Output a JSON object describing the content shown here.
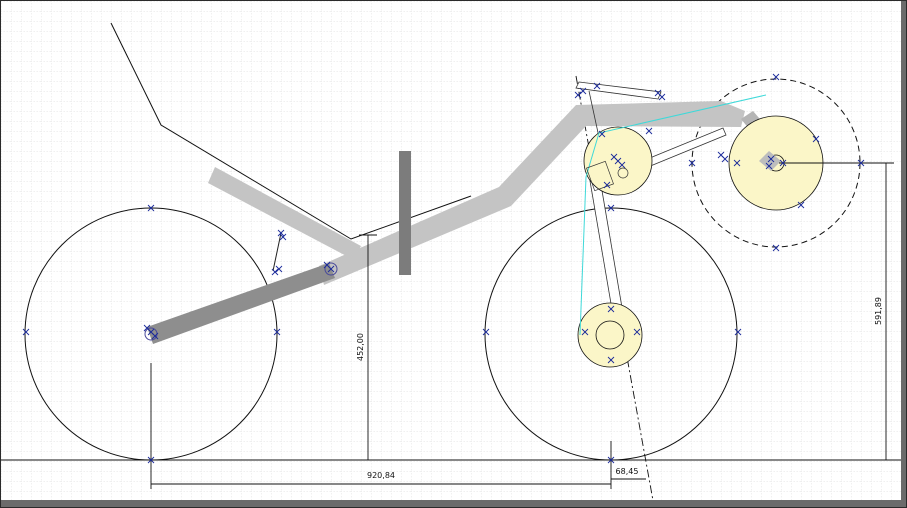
{
  "drawing": {
    "title": "",
    "dimensions": {
      "wheelbase": "920,84",
      "offset": "68,45",
      "bb_height": "452,00",
      "pedal_height": "591,89"
    }
  },
  "colors": {
    "canvas_bg": "#ffffff",
    "grid_minor": "#d6d6d6",
    "grid_major": "#bdbdbd",
    "frame_gray": "#c4c4c4",
    "boom_dark": "#8e8e8e",
    "wheel_line": "#111111",
    "hub_fill": "#fbf6c8",
    "control_point": "#1a2a9a",
    "chain_line": "#3fd9d9"
  },
  "icons": [
    "control-point-marker-icon",
    "pivot-node-icon"
  ]
}
